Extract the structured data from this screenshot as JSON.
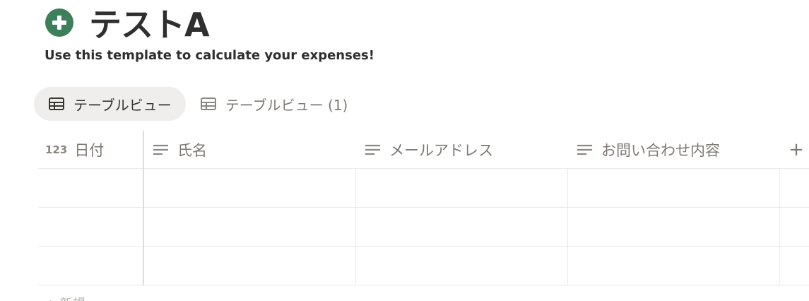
{
  "page": {
    "icon": "green-plus-circle-icon",
    "title": "テストA",
    "description": "Use this template to calculate your expenses!"
  },
  "views": [
    {
      "label": "テーブルビュー",
      "icon": "table-icon",
      "active": true
    },
    {
      "label": "テーブルビュー (1)",
      "icon": "table-icon",
      "active": false
    }
  ],
  "table": {
    "columns": [
      {
        "type_icon": "123",
        "label": "日付"
      },
      {
        "type_icon": "text-lines-icon",
        "label": "氏名"
      },
      {
        "type_icon": "text-lines-icon",
        "label": "メールアドレス"
      },
      {
        "type_icon": "text-lines-icon",
        "label": "お問い合わせ内容"
      }
    ],
    "add_column_label": "+",
    "empty_rows": 3,
    "new_row_label": "+ 新規"
  },
  "colors": {
    "icon_green": "#3d7f5b",
    "active_tab_bg": "#efeeec",
    "muted_text": "#7d7a75",
    "border": "#e9e9e7"
  }
}
